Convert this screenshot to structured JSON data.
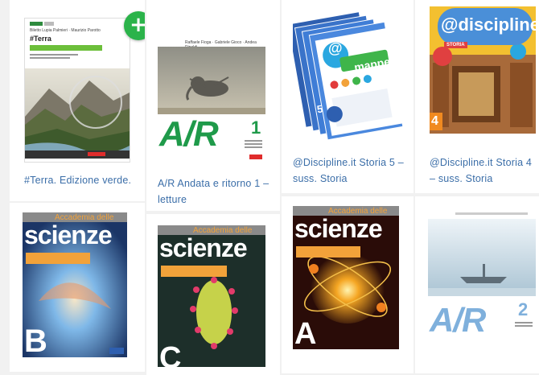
{
  "add_button": {
    "icon": "plus-icon",
    "glyph": "+"
  },
  "books": [
    {
      "title": "#Terra. Edizione verde.",
      "cover": {
        "authors": "Biletto Lupia Palmieri · Maurizio Parotto",
        "series": "#Terra",
        "tag": "MULTIMEDIALE",
        "edition": "EDIZIONE VERDE"
      }
    },
    {
      "title": "A/R Andata e ritorno 1 – letture",
      "cover": {
        "authors": "Raffaele Fioga · Gabriele Gioco · Andea Rinaldi",
        "logo": "A/R",
        "volume": "1"
      }
    },
    {
      "title": "@Discipline.it Storia 5 – suss. Storia",
      "cover": {
        "brand": "@",
        "word": "mappe",
        "volume": "5"
      }
    },
    {
      "title": "@Discipline.it Storia 4 – suss. Storia",
      "cover": {
        "brand": "@discipline",
        "subject": "STORIA",
        "volume": "4"
      }
    },
    {
      "title": "",
      "cover": {
        "header": "Accademia delle",
        "word": "scienze",
        "volume": "B"
      }
    },
    {
      "title": "",
      "cover": {
        "header": "Accademia delle",
        "word": "scienze",
        "volume": "C"
      }
    },
    {
      "title": "",
      "cover": {
        "header": "Accademia delle",
        "word": "scienze",
        "volume": "A"
      }
    },
    {
      "title": "",
      "cover": {
        "logo": "A/R",
        "volume": "2"
      }
    }
  ],
  "colors": {
    "title_link": "#3b6ea8",
    "add_green": "#2bb34a",
    "ar_green": "#1f9a4a",
    "sci_orange": "#f2a23a"
  }
}
